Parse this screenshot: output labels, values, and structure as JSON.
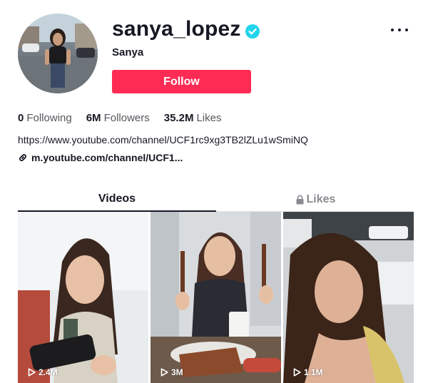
{
  "profile": {
    "username": "sanya_lopez",
    "nickname": "Sanya",
    "verified": true,
    "follow_label": "Follow"
  },
  "stats": {
    "following_count": "0",
    "following_label": "Following",
    "followers_count": "6M",
    "followers_label": "Followers",
    "likes_count": "35.2M",
    "likes_label": "Likes"
  },
  "bio": {
    "text": "https://www.youtube.com/channel/UCF1rc9xg3TB2lZLu1wSmiNQ",
    "link": "m.youtube.com/channel/UCF1..."
  },
  "tabs": [
    {
      "label": "Videos",
      "active": true
    },
    {
      "label": "Likes",
      "active": false,
      "locked": true
    }
  ],
  "videos": [
    {
      "views": "2.4M"
    },
    {
      "views": "3M"
    },
    {
      "views": "1.1M"
    }
  ],
  "colors": {
    "accent": "#fe2c55",
    "verified": "#20d5ec",
    "text": "#161823",
    "muted": "#8a8b91"
  },
  "icons": {
    "verified": "verified-badge-icon",
    "more": "more-horizontal-icon",
    "link": "link-icon",
    "lock": "lock-icon",
    "play": "play-icon"
  }
}
